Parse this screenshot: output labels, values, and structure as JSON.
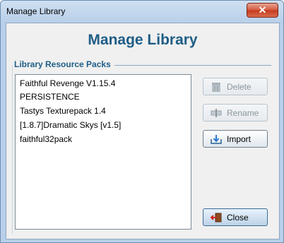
{
  "window": {
    "title": "Manage Library",
    "close_glyph": "✕"
  },
  "heading": "Manage Library",
  "group_label": "Library Resource Packs",
  "packs": [
    "Faithful Revenge V1.15.4",
    "PERSISTENCE",
    "Tastys Texturepack 1.4",
    "[1.8.7]Dramatic Skys [v1.5]",
    "faithful32pack"
  ],
  "buttons": {
    "delete": {
      "label": "Delete",
      "icon": "trash-icon",
      "enabled": false
    },
    "rename": {
      "label": "Rename",
      "icon": "rename-icon",
      "enabled": false
    },
    "import": {
      "label": "Import",
      "icon": "import-icon",
      "enabled": true
    },
    "close": {
      "label": "Close",
      "icon": "exit-door-icon",
      "enabled": true
    }
  },
  "colors": {
    "heading": "#1f5d86",
    "titlebar": "#b9d0ea",
    "close_button": "#c43a1b"
  }
}
